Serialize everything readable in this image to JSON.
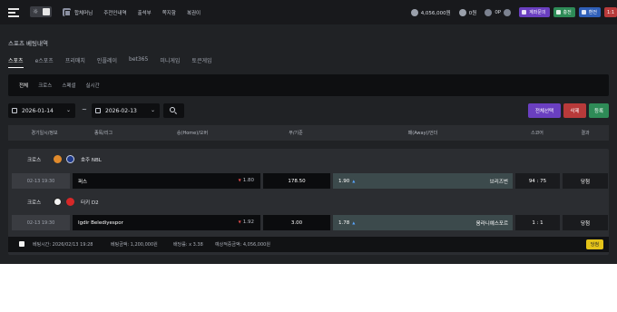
{
  "topbar": {
    "nav": [
      "합체머님",
      "주전인내역",
      "출석부",
      "쪽지함",
      "복권이"
    ],
    "balance": "4,056,000원",
    "point": "0원",
    "points_label": "0P",
    "buttons": {
      "mypage": "계좌문의",
      "deposit": "충전",
      "withdraw": "환전",
      "page": "1:1"
    }
  },
  "page": {
    "title": "스포츠 베팅내역",
    "tabs": [
      "스포츠",
      "e스포츠",
      "프리매치",
      "인플레이",
      "bet365",
      "미니게임",
      "토큰게임"
    ],
    "filters": [
      "전체",
      "크로스",
      "스페셜",
      "실시간"
    ]
  },
  "dates": {
    "from": "2026-01-14",
    "separator": "~",
    "to": "2026-02-13"
  },
  "actions": {
    "select_all": "전체선택",
    "delete": "삭제",
    "register": "등록"
  },
  "table": {
    "headers": [
      "경기일시/정보",
      "종목/리그",
      "승(Home)/오버",
      "무/기준",
      "패(Away)/언더",
      "스코어",
      "결과"
    ]
  },
  "bets": [
    {
      "type": "크로스",
      "league": "호주 NBL",
      "time": "02-13 19:30",
      "home": "퍼스",
      "home_odds": "1.80",
      "draw": "178.50",
      "away_odds": "1.90",
      "away": "브리즈번",
      "score": "94 : 75",
      "result": "당첨"
    },
    {
      "type": "크로스",
      "league": "터키 D2",
      "time": "02-13 19:30",
      "home": "Igdir Belediyespor",
      "home_odds": "1.92",
      "draw": "3.00",
      "away_odds": "1.78",
      "away": "움라니예스포르",
      "score": "1 : 1",
      "result": "당첨"
    }
  ],
  "summary": {
    "bet_time": "베팅시간: 2026/02/13 19:28",
    "bet_amount": "베팅금액: 1,200,000원",
    "bet_odds": "배당률: x 3.38",
    "expected": "예상적중금액: 4,056,000원",
    "status": "당첨"
  }
}
